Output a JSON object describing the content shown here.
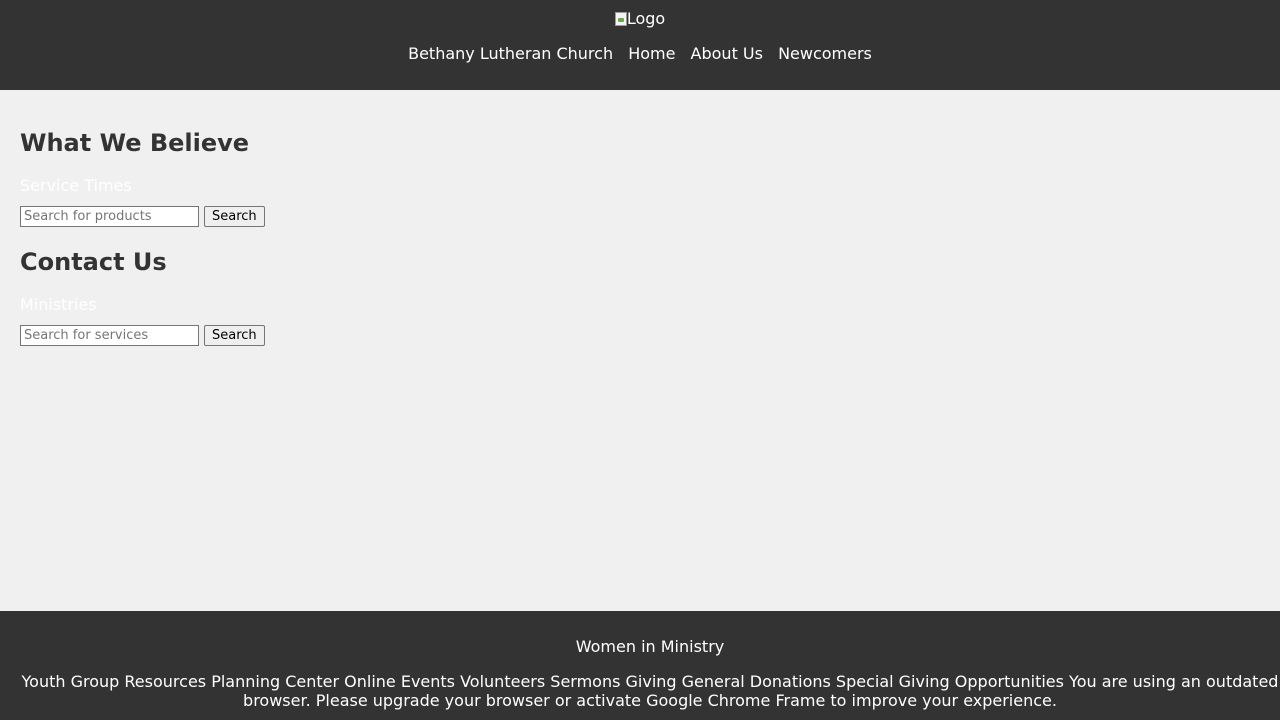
{
  "header": {
    "logo_alt": "Logo",
    "nav": [
      "Bethany Lutheran Church",
      "Home",
      "About Us",
      "Newcomers"
    ]
  },
  "main": {
    "section1": {
      "heading": "What We Believe",
      "link": "Service Times",
      "search_placeholder": "Search for products",
      "search_button": "Search"
    },
    "section2": {
      "heading": "Contact Us",
      "link": "Ministries",
      "search_placeholder": "Search for services",
      "search_button": "Search"
    }
  },
  "footer": {
    "title": "Women in Ministry",
    "text": "Youth Group Resources Planning Center Online Events Volunteers Sermons Giving General Donations Special Giving Opportunities You are using an outdated browser. Please upgrade your browser or activate Google Chrome Frame to improve your experience."
  },
  "colors": {
    "header_bg": "#333333",
    "body_bg": "#f0f0f0",
    "heading": "#333333",
    "link_text": "#ffffff"
  }
}
